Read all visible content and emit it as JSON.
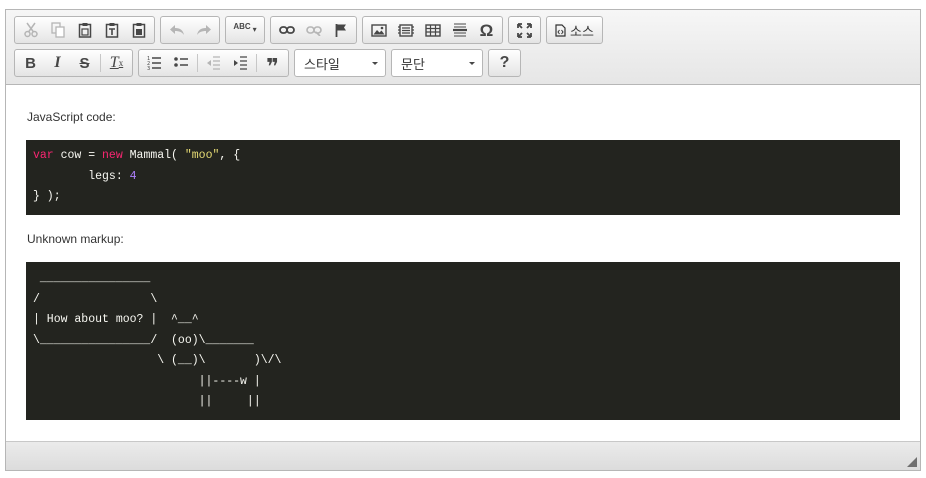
{
  "toolbar": {
    "row1": {
      "clipboard": [
        "cut-icon",
        "copy-icon",
        "paste-icon",
        "paste-text-icon",
        "paste-word-icon"
      ],
      "history": [
        "undo-icon",
        "redo-icon"
      ],
      "spellcheck_label": "ABC",
      "links": [
        "link-icon",
        "unlink-icon",
        "anchor-flag-icon"
      ],
      "insert": [
        "image-icon",
        "embed-icon",
        "table-icon",
        "horizontal-rule-icon"
      ],
      "special_char_label": "Ω",
      "maximize": "maximize-icon",
      "source_label": "소스"
    },
    "row2": {
      "bold_label": "B",
      "italic_label": "I",
      "strike_label": "S",
      "remove_format_label": "T",
      "blockquote_label": "❞",
      "style_combo": "스타일",
      "format_combo": "문단",
      "help_label": "?"
    }
  },
  "content": {
    "label1": "JavaScript code:",
    "code1": {
      "kw_var": "var",
      "p1": " cow = ",
      "kw_new": "new",
      "p2": " Mammal( ",
      "str": "\"moo\"",
      "p3": ", {",
      "line2a": "        legs: ",
      "num": "4",
      "line3": "} );"
    },
    "label2": "Unknown markup:",
    "code2": " ________________\n/                \\\n| How about moo? |  ^__^\n\\________________/  (oo)\\_______\n                  \\ (__)\\       )\\/\\\n                        ||----w |\n                        ||     ||"
  },
  "colors": {
    "code_bg": "#23241f",
    "keyword": "#f92672",
    "string": "#e6db74",
    "number": "#ae81ff"
  }
}
